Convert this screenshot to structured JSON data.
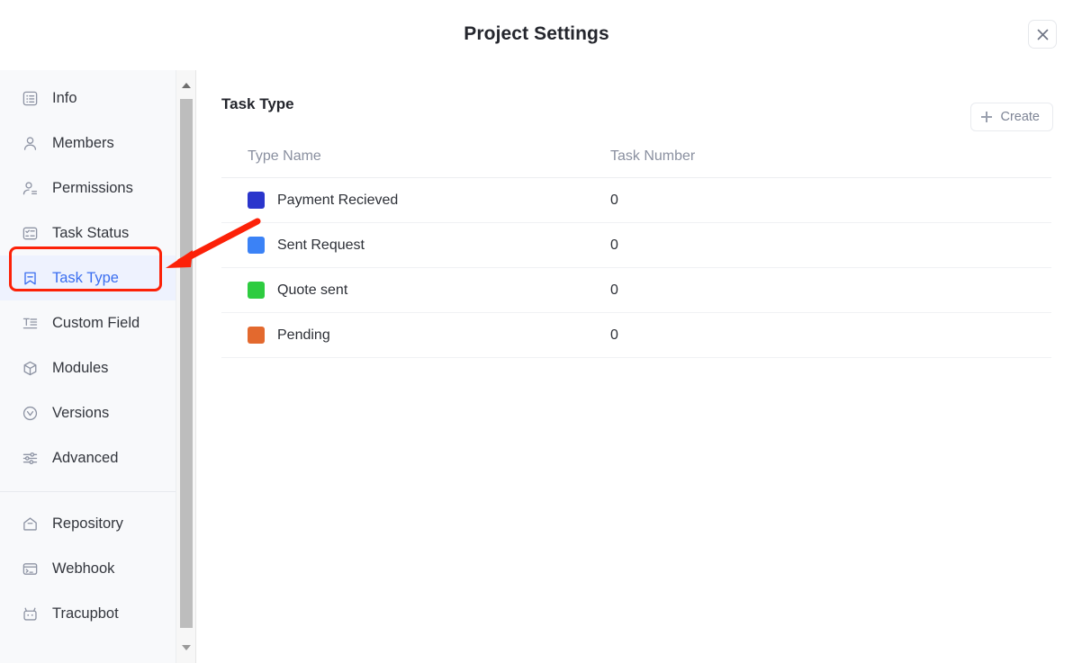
{
  "header": {
    "title": "Project Settings",
    "close_icon": "close-icon"
  },
  "sidebar": {
    "groups": [
      {
        "items": [
          {
            "label": "Info",
            "icon": "info-list-icon",
            "active": false
          },
          {
            "label": "Members",
            "icon": "user-icon",
            "active": false
          },
          {
            "label": "Permissions",
            "icon": "user-lines-icon",
            "active": false
          },
          {
            "label": "Task Status",
            "icon": "checklist-icon",
            "active": false
          },
          {
            "label": "Task Type",
            "icon": "bookmark-icon",
            "active": true
          },
          {
            "label": "Custom Field",
            "icon": "text-field-icon",
            "active": false
          },
          {
            "label": "Modules",
            "icon": "cube-icon",
            "active": false
          },
          {
            "label": "Versions",
            "icon": "version-circle-icon",
            "active": false
          },
          {
            "label": "Advanced",
            "icon": "sliders-icon",
            "active": false
          }
        ]
      },
      {
        "items": [
          {
            "label": "Repository",
            "icon": "repository-icon",
            "active": false
          },
          {
            "label": "Webhook",
            "icon": "terminal-icon",
            "active": false
          },
          {
            "label": "Tracupbot",
            "icon": "robot-icon",
            "active": false
          }
        ]
      }
    ],
    "scrollbar": {
      "up_icon": "scroll-up-arrow-icon",
      "down_icon": "scroll-down-arrow-icon"
    }
  },
  "main": {
    "section_title": "Task Type",
    "create_label": "Create",
    "create_icon": "plus-icon",
    "table": {
      "columns": [
        "Type Name",
        "Task Number"
      ],
      "rows": [
        {
          "color": "#2a35cc",
          "name": "Payment Recieved",
          "count": "0"
        },
        {
          "color": "#3b82f6",
          "name": "Sent Request",
          "count": "0"
        },
        {
          "color": "#2ecc40",
          "name": "Quote sent",
          "count": "0"
        },
        {
          "color": "#e3692e",
          "name": "Pending",
          "count": "0"
        }
      ]
    }
  },
  "annotation": {
    "highlight_color": "#fc2108",
    "target": "Task Type"
  }
}
